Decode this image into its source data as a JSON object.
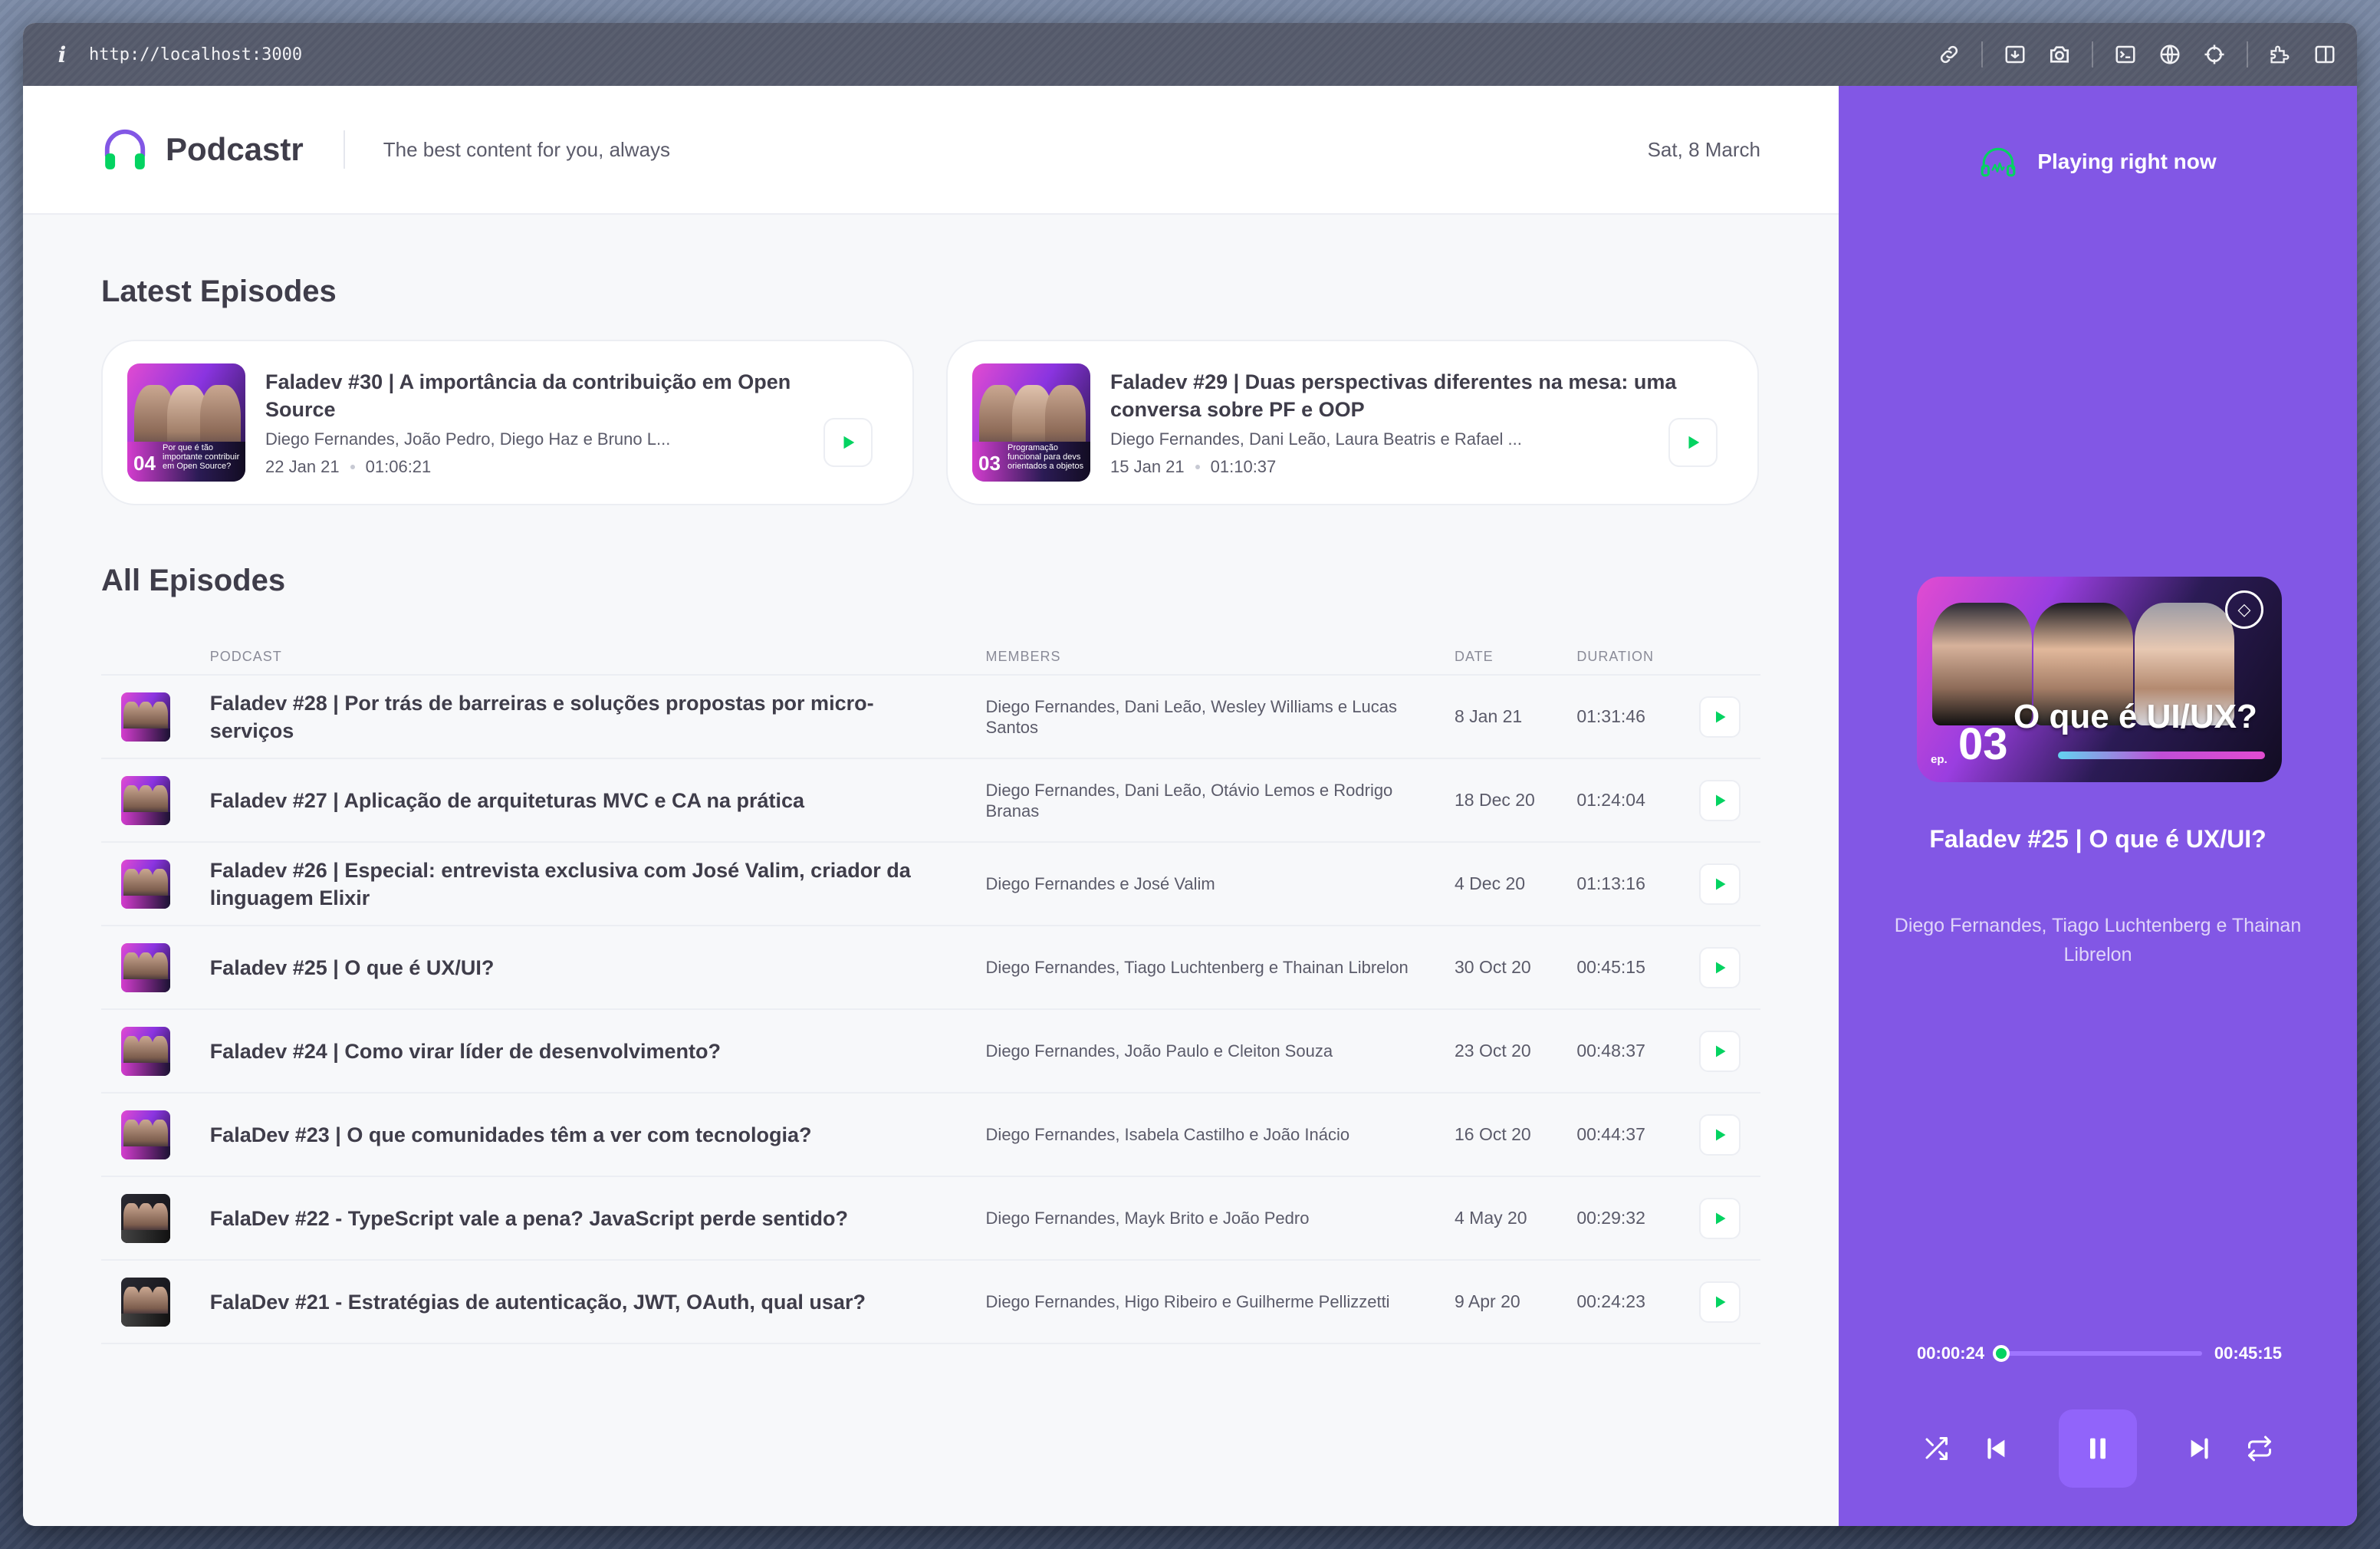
{
  "browser": {
    "info_icon": "i",
    "url": "http://localhost:3000",
    "tools": [
      "link-icon",
      "screenshot-area-icon",
      "camera-icon",
      "terminal-icon",
      "globe-icon",
      "crosshair-icon",
      "extension-icon",
      "split-view-icon"
    ]
  },
  "header": {
    "logo_text": "Podcastr",
    "tagline": "The best content for you, always",
    "date": "Sat, 8 March"
  },
  "latest": {
    "section_title": "Latest Episodes",
    "episodes": [
      {
        "title": "Faladev #30 | A importância da contribuição em Open Source",
        "members": "Diego Fernandes, João Pedro, Diego Haz e Bruno L...",
        "date": "22 Jan 21",
        "duration": "01:06:21",
        "thumb_num": "04",
        "thumb_caption": "Por que é tão importante contribuir em Open Source?"
      },
      {
        "title": "Faladev #29 | Duas perspectivas diferentes na mesa: uma conversa sobre PF e OOP",
        "members": "Diego Fernandes, Dani Leão, Laura Beatris e Rafael ...",
        "date": "15 Jan 21",
        "duration": "01:10:37",
        "thumb_num": "03",
        "thumb_caption": "Programação funcional para devs orientados a objetos"
      }
    ]
  },
  "all": {
    "section_title": "All Episodes",
    "columns": {
      "podcast": "PODCAST",
      "members": "MEMBERS",
      "date": "DATE",
      "duration": "DURATION"
    },
    "rows": [
      {
        "title": "Faladev #28 | Por trás de barreiras e soluções propostas por micro-serviços",
        "members": "Diego Fernandes, Dani Leão, Wesley Williams e Lucas Santos",
        "date": "8 Jan 21",
        "duration": "01:31:46"
      },
      {
        "title": "Faladev #27 | Aplicação de arquiteturas MVC e CA na prática",
        "members": "Diego Fernandes, Dani Leão, Otávio Lemos e Rodrigo Branas",
        "date": "18 Dec 20",
        "duration": "01:24:04"
      },
      {
        "title": "Faladev #26 | Especial: entrevista exclusiva com José Valim, criador da linguagem Elixir",
        "members": "Diego Fernandes e José Valim",
        "date": "4 Dec 20",
        "duration": "01:13:16"
      },
      {
        "title": "Faladev #25 | O que é UX/UI?",
        "members": "Diego Fernandes, Tiago Luchtenberg e Thainan Librelon",
        "date": "30 Oct 20",
        "duration": "00:45:15"
      },
      {
        "title": "Faladev #24 | Como virar líder de desenvolvimento?",
        "members": "Diego Fernandes, João Paulo e Cleiton Souza",
        "date": "23 Oct 20",
        "duration": "00:48:37"
      },
      {
        "title": "FalaDev #23 | O que comunidades têm a ver com tecnologia?",
        "members": "Diego Fernandes, Isabela Castilho e João Inácio",
        "date": "16 Oct 20",
        "duration": "00:44:37"
      },
      {
        "title": "FalaDev #22 - TypeScript vale a pena? JavaScript perde sentido?",
        "members": "Diego Fernandes, Mayk Brito e João Pedro",
        "date": "4 May 20",
        "duration": "00:29:32"
      },
      {
        "title": "FalaDev #21 - Estratégias de autenticação, JWT, OAuth, qual usar?",
        "members": "Diego Fernandes, Higo Ribeiro e Guilherme Pellizzetti",
        "date": "9 Apr 20",
        "duration": "00:24:23"
      }
    ]
  },
  "player": {
    "header": "Playing right now",
    "cover_ep_label": "ep.",
    "cover_ep_num": "03",
    "cover_title": "O que é UI/UX?",
    "title": "Faladev #25 | O que é UX/UI?",
    "members": "Diego Fernandes, Tiago Luchtenberg e Thainan Librelon",
    "current_time": "00:00:24",
    "total_time": "00:45:15",
    "progress_fraction": 0.009
  },
  "colors": {
    "accent": "#8257e5",
    "play_green": "#04d361",
    "text_dark": "#3f3d4a",
    "text_muted": "#5b5b6a"
  }
}
